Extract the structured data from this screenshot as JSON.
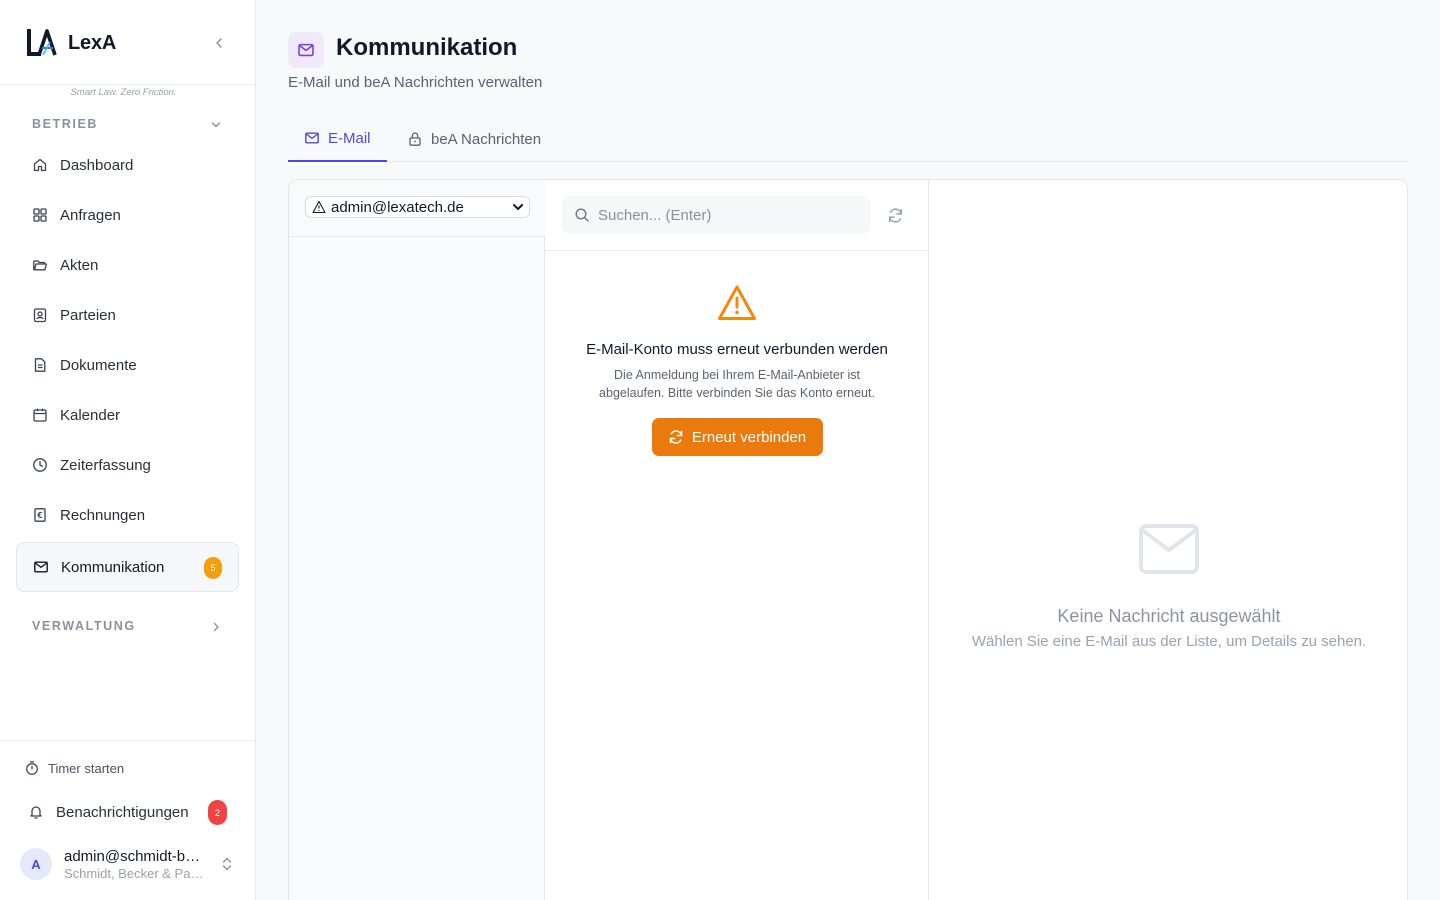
{
  "brand": {
    "name": "LexA",
    "tagline": "Smart Law. Zero Friction."
  },
  "sidebar": {
    "section_betrieb": "BETRIEB",
    "section_verwaltung": "VERWALTUNG",
    "items": [
      {
        "label": "Dashboard",
        "icon": "home-icon"
      },
      {
        "label": "Anfragen",
        "icon": "grid-icon"
      },
      {
        "label": "Akten",
        "icon": "folder-icon"
      },
      {
        "label": "Parteien",
        "icon": "contact-icon"
      },
      {
        "label": "Dokumente",
        "icon": "document-icon"
      },
      {
        "label": "Kalender",
        "icon": "calendar-icon"
      },
      {
        "label": "Zeiterfassung",
        "icon": "clock-icon"
      },
      {
        "label": "Rechnungen",
        "icon": "invoice-icon"
      },
      {
        "label": "Kommunikation",
        "icon": "mail-icon",
        "badge": "5",
        "active": true
      }
    ],
    "timer_label": "Timer starten",
    "notifications_label": "Benachrichtigungen",
    "notifications_badge": "2",
    "user": {
      "initial": "A",
      "email": "admin@schmidt-becker.de",
      "org": "Schmidt, Becker & Partner"
    }
  },
  "page": {
    "title": "Kommunikation",
    "subtitle": "E-Mail und beA Nachrichten verwalten"
  },
  "tabs": [
    {
      "label": "E-Mail",
      "active": true
    },
    {
      "label": "beA Nachrichten",
      "active": false
    }
  ],
  "mail": {
    "account": "admin@lexatech.de",
    "search_placeholder": "Suchen... (Enter)",
    "reconnect": {
      "title": "E-Mail-Konto muss erneut verbunden werden",
      "description": "Die Anmeldung bei Ihrem E-Mail-Anbieter ist abgelaufen. Bitte verbinden Sie das Konto erneut.",
      "button": "Erneut verbinden"
    },
    "empty": {
      "title": "Keine Nachricht ausgewählt",
      "description": "Wählen Sie eine E-Mail aus der Liste, um Details zu sehen."
    }
  },
  "colors": {
    "accent": "#4f46e5",
    "warning": "#ea7a0c",
    "badge_orange": "#f59e0b",
    "badge_red": "#ef4444"
  }
}
